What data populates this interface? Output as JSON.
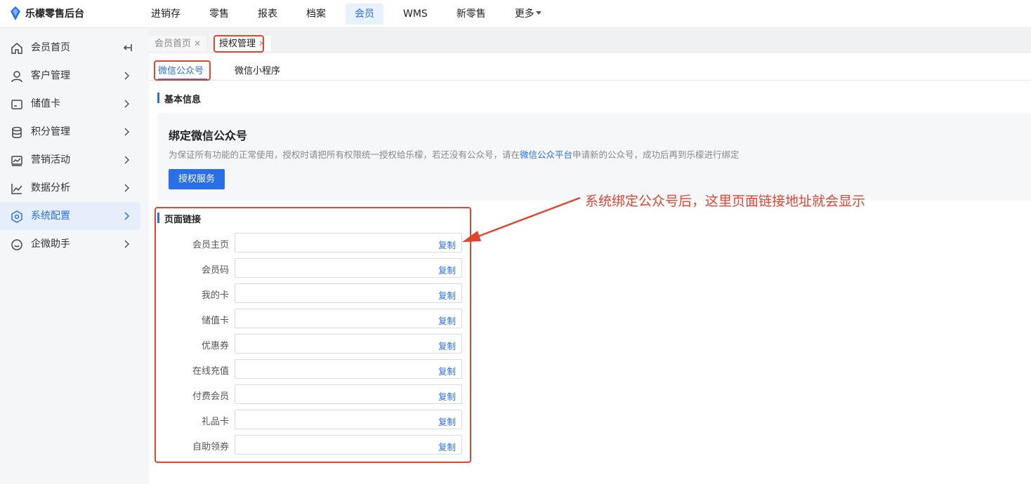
{
  "app": {
    "title": "乐檬零售后台"
  },
  "topnav": [
    {
      "label": "进销存",
      "active": false
    },
    {
      "label": "零售",
      "active": false
    },
    {
      "label": "报表",
      "active": false
    },
    {
      "label": "档案",
      "active": false
    },
    {
      "label": "会员",
      "active": true
    },
    {
      "label": "WMS",
      "active": false
    },
    {
      "label": "新零售",
      "active": false
    },
    {
      "label": "更多",
      "active": false,
      "dropdown": true
    }
  ],
  "sidebar": {
    "items": [
      {
        "label": "会员首页",
        "icon": "home-icon"
      },
      {
        "label": "客户管理",
        "icon": "user-icon"
      },
      {
        "label": "储值卡",
        "icon": "card-icon"
      },
      {
        "label": "积分管理",
        "icon": "database-icon"
      },
      {
        "label": "营销活动",
        "icon": "chart-screen-icon"
      },
      {
        "label": "数据分析",
        "icon": "line-chart-icon"
      },
      {
        "label": "系统配置",
        "icon": "settings-icon",
        "active": true
      },
      {
        "label": "企微助手",
        "icon": "chat-icon"
      }
    ]
  },
  "tabs": [
    {
      "label": "会员首页",
      "close": "✕"
    },
    {
      "label": "授权管理",
      "close": "✕"
    }
  ],
  "subtabs": [
    {
      "label": "微信公众号",
      "active": true
    },
    {
      "label": "微信小程序",
      "active": false
    }
  ],
  "basic_info": {
    "title": "基本信息",
    "bind_title": "绑定微信公众号",
    "desc_before": "为保证所有功能的正常使用，授权时请把所有权限统一授权给乐檬，若还没有公众号，请在",
    "desc_link": "微信公众平台",
    "desc_after": "申请新的公众号，成功后再到乐檬进行绑定",
    "auth_button": "授权服务"
  },
  "page_links": {
    "title": "页面链接",
    "copy_label": "复制",
    "rows": [
      {
        "label": "会员主页",
        "value": ""
      },
      {
        "label": "会员码",
        "value": ""
      },
      {
        "label": "我的卡",
        "value": ""
      },
      {
        "label": "储值卡",
        "value": ""
      },
      {
        "label": "优惠券",
        "value": ""
      },
      {
        "label": "在线充值",
        "value": ""
      },
      {
        "label": "付费会员",
        "value": ""
      },
      {
        "label": "礼品卡",
        "value": ""
      },
      {
        "label": "自助领券",
        "value": ""
      }
    ]
  },
  "annotation": {
    "text": "系统绑定公众号后，这里页面链接地址就会显示",
    "color": "#e2452f"
  },
  "colors": {
    "accent": "#2a6ee8",
    "annotation": "#e2452f"
  }
}
